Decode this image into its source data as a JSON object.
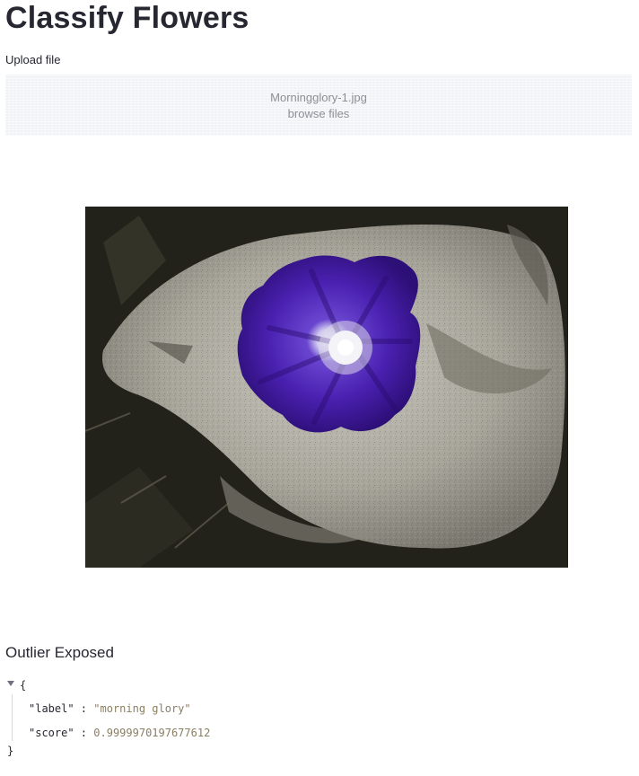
{
  "header": {
    "title": "Classify Flowers"
  },
  "uploader": {
    "label": "Upload file",
    "filename": "Morningglory-1.jpg",
    "browse_label": "browse files"
  },
  "image": {
    "icon": "uploaded-photo-morning-glory"
  },
  "result": {
    "section_title": "Outlier Exposed",
    "json_open": "{",
    "json_close": "}",
    "fields": [
      {
        "key": "\"label\"",
        "sep": " : ",
        "value": "\"morning glory\""
      },
      {
        "key": "\"score\"",
        "sep": " : ",
        "value": "0.9999970197677612"
      }
    ]
  },
  "colors": {
    "text": "#262730",
    "dropzone_bg": "#f0f2f6",
    "json_value": "#8a7f62",
    "flower": "#4b22a8"
  }
}
